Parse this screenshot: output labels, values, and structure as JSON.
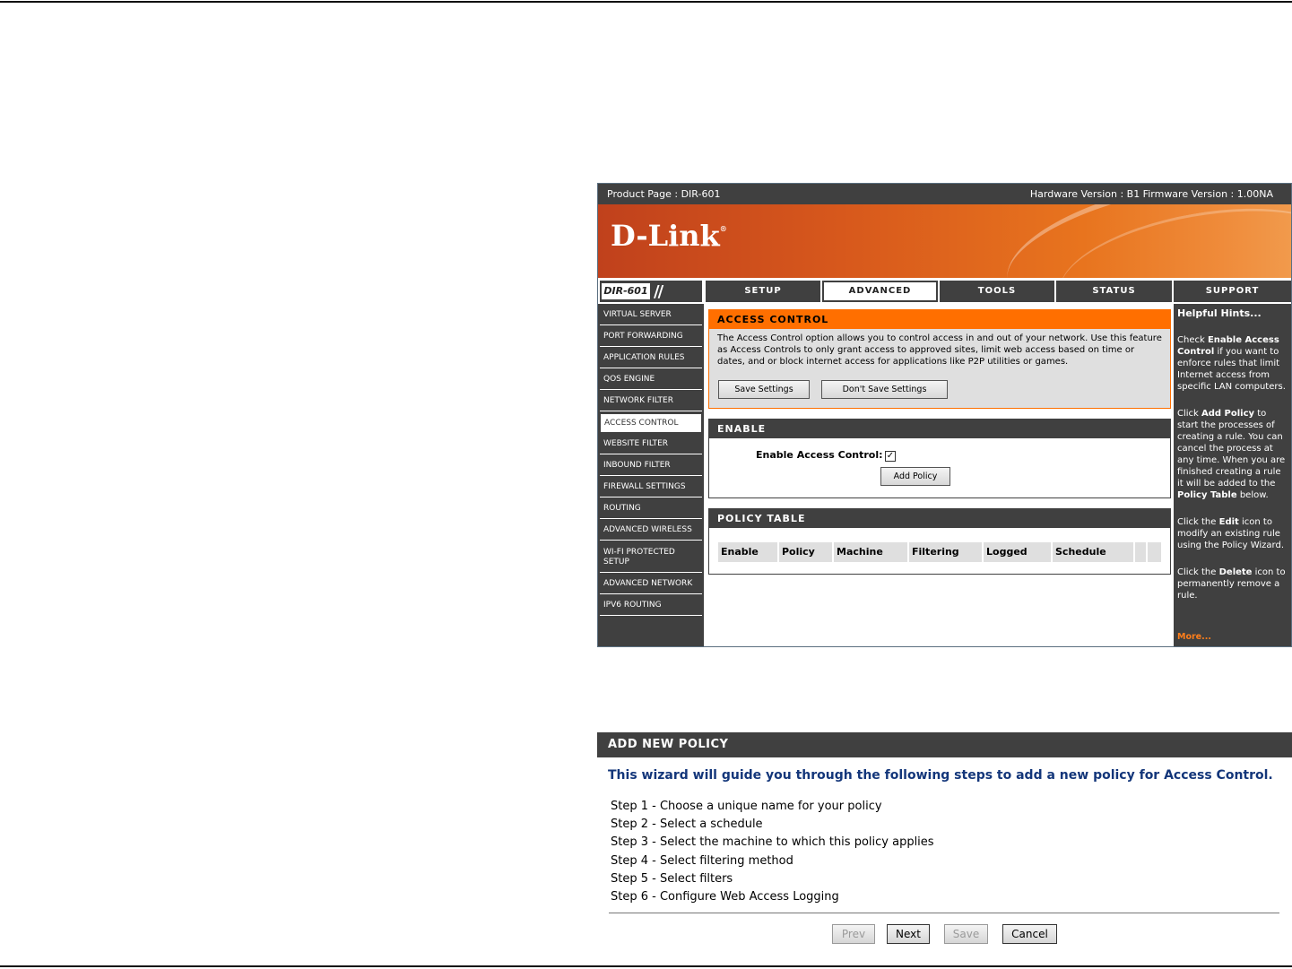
{
  "router": {
    "product_page": "Product Page : DIR-601",
    "versions": "Hardware Version : B1   Firmware Version : 1.00NA",
    "logo": "D-Link",
    "model": "DIR-601",
    "tabs": [
      {
        "label": "SETUP"
      },
      {
        "label": "ADVANCED"
      },
      {
        "label": "TOOLS"
      },
      {
        "label": "STATUS"
      },
      {
        "label": "SUPPORT"
      }
    ],
    "sidebar": [
      {
        "label": "VIRTUAL SERVER"
      },
      {
        "label": "PORT FORWARDING"
      },
      {
        "label": "APPLICATION RULES"
      },
      {
        "label": "QOS ENGINE"
      },
      {
        "label": "NETWORK FILTER"
      },
      {
        "label": "ACCESS CONTROL"
      },
      {
        "label": "WEBSITE FILTER"
      },
      {
        "label": "INBOUND FILTER"
      },
      {
        "label": "FIREWALL SETTINGS"
      },
      {
        "label": "ROUTING"
      },
      {
        "label": "ADVANCED WIRELESS"
      },
      {
        "label": "WI-FI PROTECTED SETUP"
      },
      {
        "label": "ADVANCED NETWORK"
      },
      {
        "label": "IPV6 ROUTING"
      }
    ],
    "access_control": {
      "title": "ACCESS CONTROL",
      "description": "The Access Control option allows you to control access in and out of your network. Use this feature as Access Controls to only grant access to approved sites, limit web access based on time or dates, and or block internet access for applications like P2P utilities or games.",
      "save_label": "Save Settings",
      "dont_save_label": "Don't Save Settings"
    },
    "enable": {
      "title": "ENABLE",
      "label": "Enable Access Control:",
      "checked": true,
      "add_policy_label": "Add Policy"
    },
    "policy_table": {
      "title": "POLICY TABLE",
      "columns": [
        "Enable",
        "Policy",
        "Machine",
        "Filtering",
        "Logged",
        "Schedule"
      ]
    },
    "hints": {
      "title": "Helpful Hints...",
      "p1_a": "Check ",
      "p1_b": "Enable Access Control",
      "p1_c": " if you want to enforce rules that limit Internet access from specific LAN computers.",
      "p2_a": "Click ",
      "p2_b": "Add Policy",
      "p2_c": " to start the processes of creating a rule. You can cancel the process at any time. When you are finished creating a rule it will be added to the ",
      "p2_d": "Policy Table",
      "p2_e": " below.",
      "p3_a": "Click the ",
      "p3_b": "Edit",
      "p3_c": " icon to modify an existing rule using the Policy Wizard.",
      "p4_a": "Click the ",
      "p4_b": "Delete",
      "p4_c": " icon to permanently remove a rule.",
      "more": "More..."
    }
  },
  "wizard": {
    "title": "ADD NEW POLICY",
    "intro": "This wizard will guide you through the following steps to add a new policy for Access Control.",
    "steps": [
      "Step 1 - Choose a unique name for your policy",
      "Step 2 - Select a schedule",
      "Step 3 - Select the machine to which this policy applies",
      "Step 4 - Select filtering method",
      "Step 5 - Select filters",
      "Step 6 - Configure Web Access Logging"
    ],
    "buttons": {
      "prev": "Prev",
      "next": "Next",
      "save": "Save",
      "cancel": "Cancel"
    }
  },
  "colors": {
    "dark": "#404040",
    "orange": "#ff6f00",
    "intro_blue": "#13367a",
    "more_orange": "#ff7e1a"
  }
}
